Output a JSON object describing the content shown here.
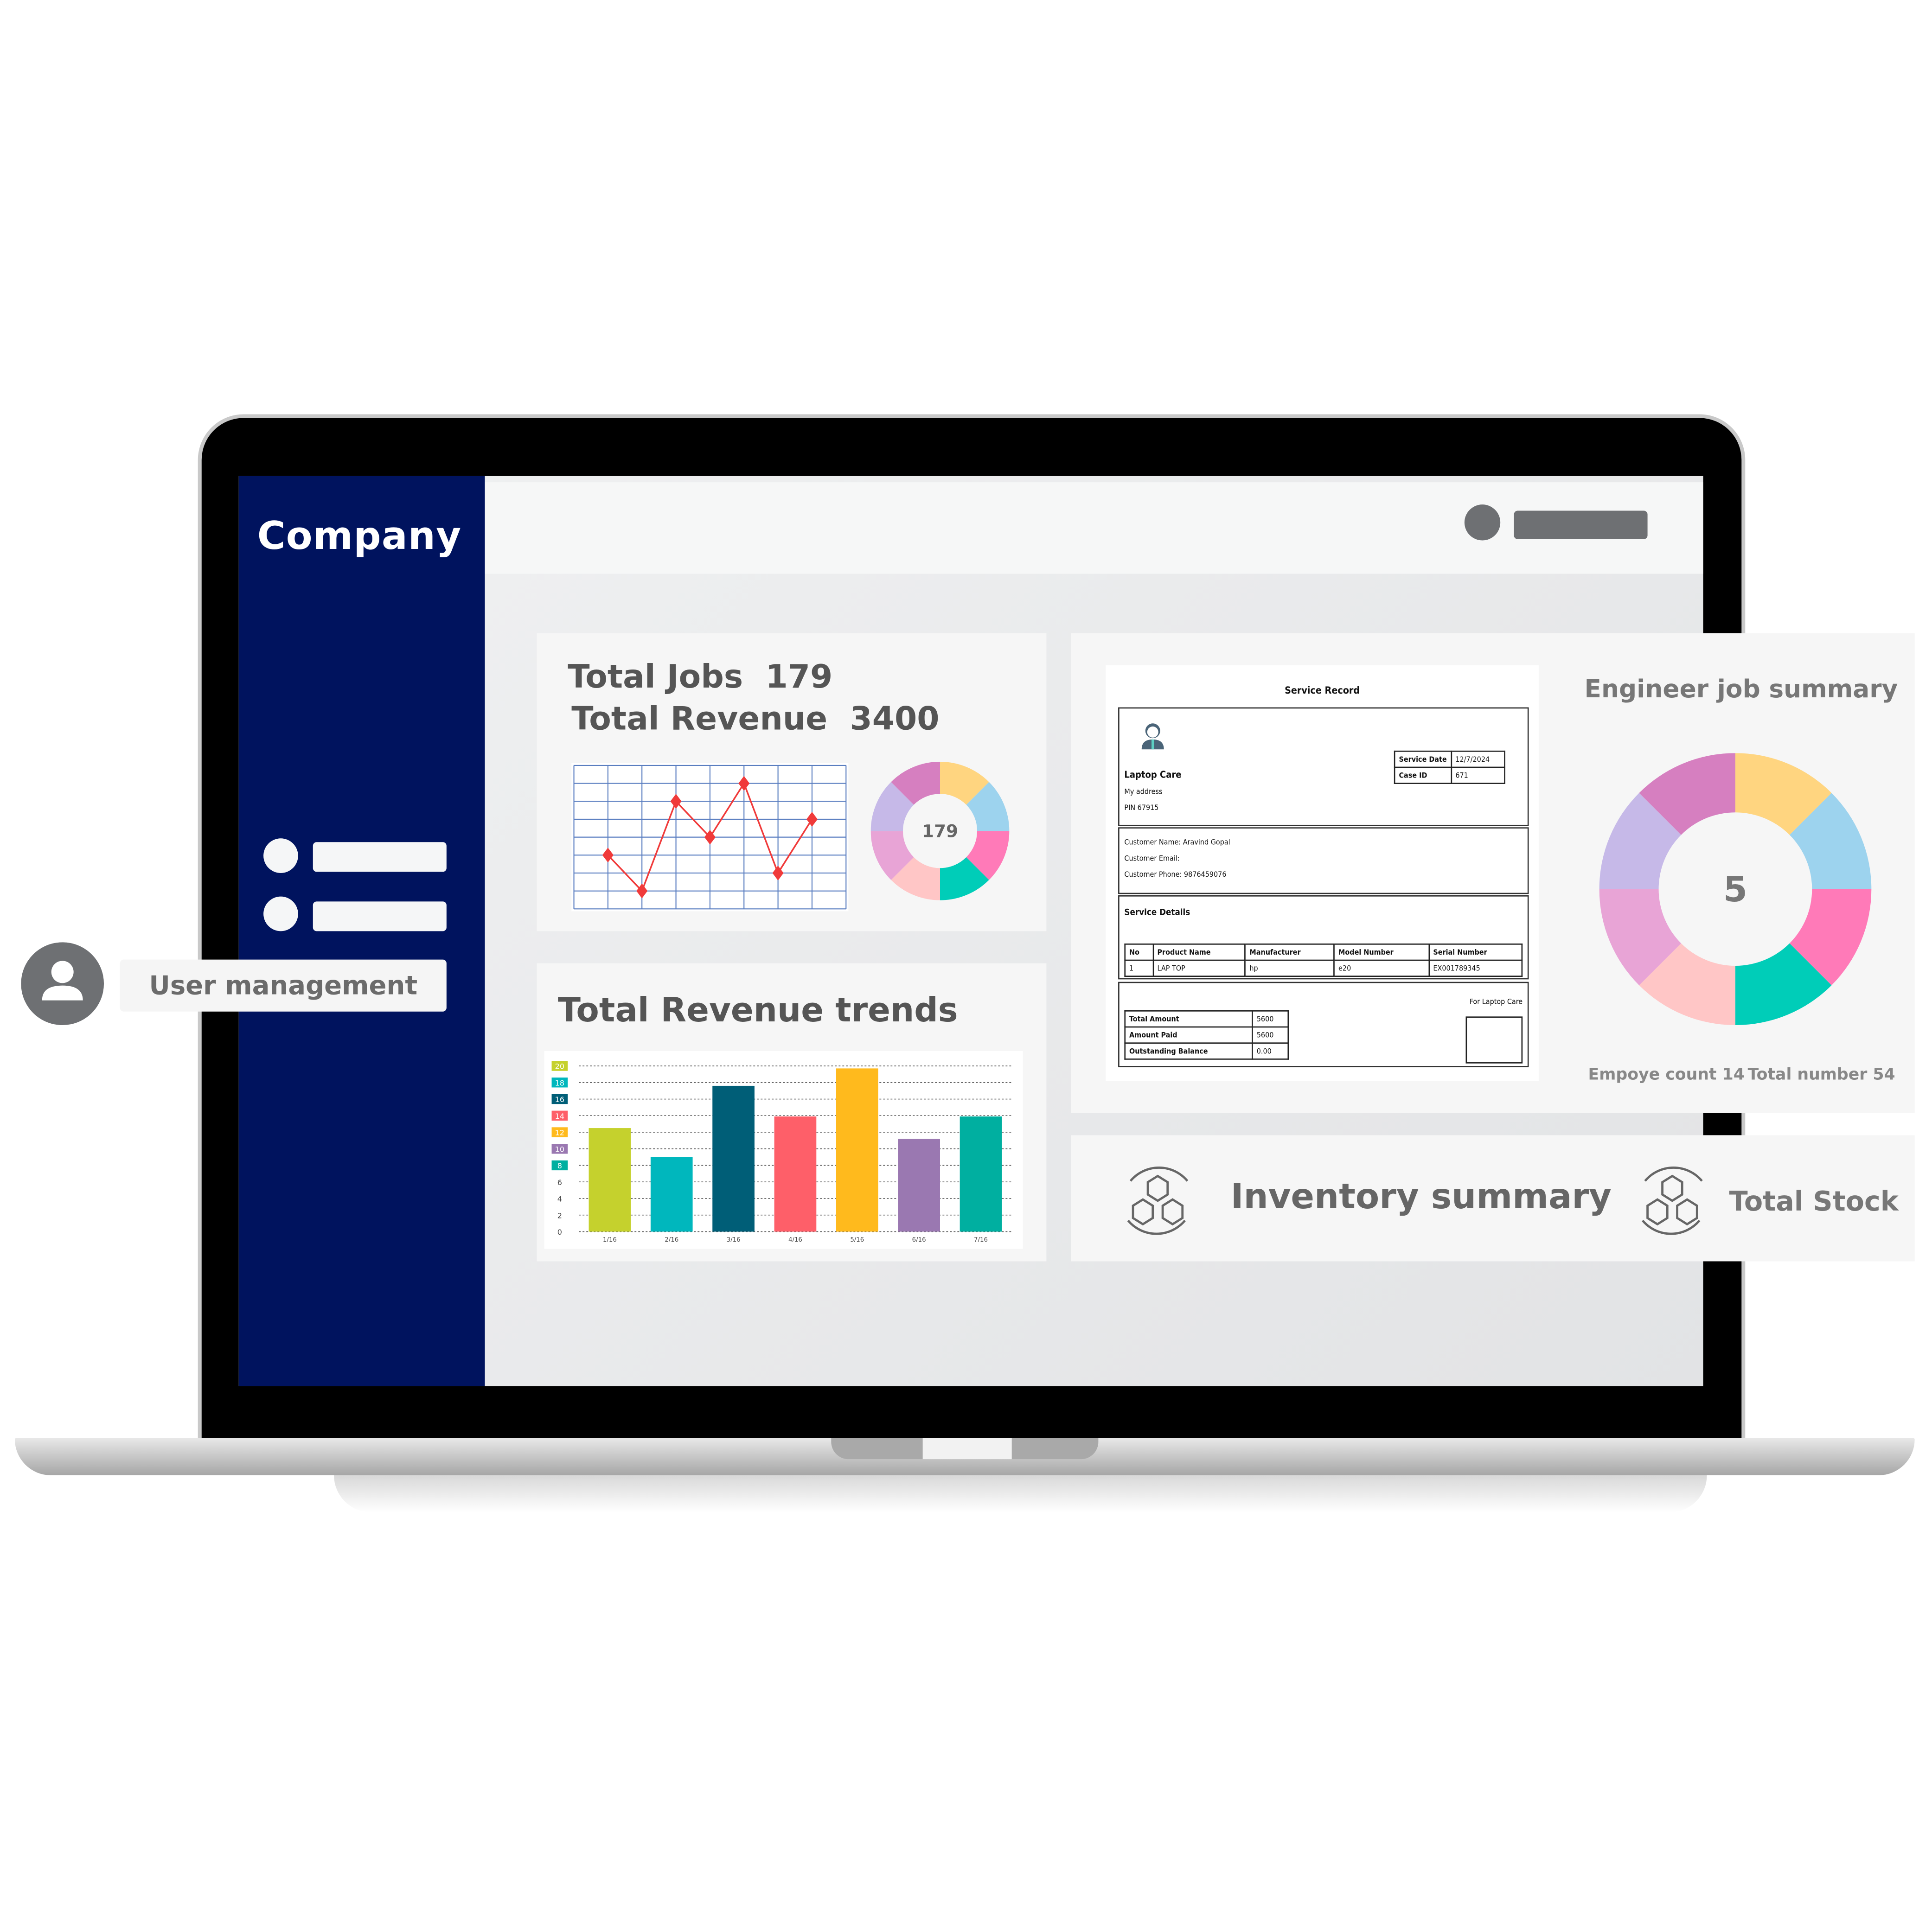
{
  "sidebar": {
    "brand": "Company",
    "items": [
      {
        "label_placeholder": true
      },
      {
        "label_placeholder": true
      }
    ],
    "user_management_label": "User management",
    "user_icon": "user-icon"
  },
  "stats_card": {
    "total_jobs_label": "Total Jobs",
    "total_jobs_value": "179",
    "total_revenue_label": "Total Revenue",
    "total_revenue_value": "3400",
    "donut_center": "179"
  },
  "revenue_trends": {
    "title": "Total Revenue trends"
  },
  "service_record": {
    "title": "Service Record",
    "company": "Laptop Care",
    "address": "My address",
    "pin": "PIN 67915",
    "service_date_label": "Service Date",
    "service_date": "12/7/2024",
    "case_id_label": "Case ID",
    "case_id": "671",
    "customer_name": "Customer Name: Aravind Gopal",
    "customer_email": "Customer Email:",
    "customer_phone": "Customer Phone: 9876459076",
    "details_title": "Service Details",
    "columns": [
      "No",
      "Product Name",
      "Manufacturer",
      "Model Number",
      "Serial Number"
    ],
    "rows": [
      [
        "1",
        "LAP TOP",
        "hp",
        "e20",
        "EX001789345"
      ]
    ],
    "totals": [
      {
        "label": "Total Amount",
        "value": "5600"
      },
      {
        "label": "Amount Paid",
        "value": "5600"
      },
      {
        "label": "Outstanding Balance",
        "value": "0.00"
      }
    ],
    "signature_label": "For Laptop Care"
  },
  "engineer_summary": {
    "title": "Engineer job summary",
    "center_value": "5",
    "employee_count": "Empoye count 14",
    "total_number": "Total number 54"
  },
  "inventory": {
    "title": "Inventory summary",
    "stock_label": "Total Stock",
    "icon": "inventory-cycle-icon"
  },
  "chart_data": [
    {
      "type": "line",
      "title": "",
      "x": [
        1,
        2,
        3,
        4,
        5,
        6,
        7
      ],
      "values": [
        3,
        1,
        6,
        4,
        7,
        2,
        5
      ],
      "xlim": [
        0,
        8
      ],
      "ylim": [
        0,
        8
      ],
      "grid": true,
      "color": "#f03a3a"
    },
    {
      "type": "pie",
      "title": "Total Jobs",
      "center_label": "179",
      "values": [
        1,
        1,
        1,
        1,
        1,
        1,
        1,
        1
      ],
      "colors": [
        "#ffd580",
        "#9dd3ee",
        "#ff7ab8",
        "#00cdb8",
        "#ffc6c6",
        "#e8a4d6",
        "#c6b9e8",
        "#d67fc0"
      ]
    },
    {
      "type": "bar",
      "title": "Total Revenue trends",
      "categories": [
        "1/16",
        "2/16",
        "3/16",
        "4/16",
        "5/16",
        "6/16",
        "7/16"
      ],
      "values": [
        12.5,
        9,
        17.6,
        13.9,
        19.7,
        11.2,
        13.9
      ],
      "colors": [
        "#c5d12d",
        "#00b7bd",
        "#005e77",
        "#fe5f69",
        "#ffba1d",
        "#9a78b1",
        "#00afa0"
      ],
      "yticks": [
        0,
        2,
        4,
        6,
        8,
        10,
        12,
        14,
        16,
        18,
        20
      ],
      "ytick_colors": {
        "8": "#00afa0",
        "10": "#9a78b1",
        "12": "#ffba1d",
        "14": "#fe5f69",
        "16": "#005e77",
        "18": "#00b7bd",
        "20": "#c5d12d"
      },
      "ylim": [
        0,
        20
      ],
      "grid": true
    },
    {
      "type": "pie",
      "title": "Engineer job summary",
      "center_label": "5",
      "values": [
        1,
        1,
        1,
        1,
        1,
        1,
        1,
        1
      ],
      "colors": [
        "#ffd580",
        "#9dd3ee",
        "#ff7ab8",
        "#00cdb8",
        "#ffc6c6",
        "#e8a4d6",
        "#c6b9e8",
        "#d67fc0"
      ]
    }
  ]
}
